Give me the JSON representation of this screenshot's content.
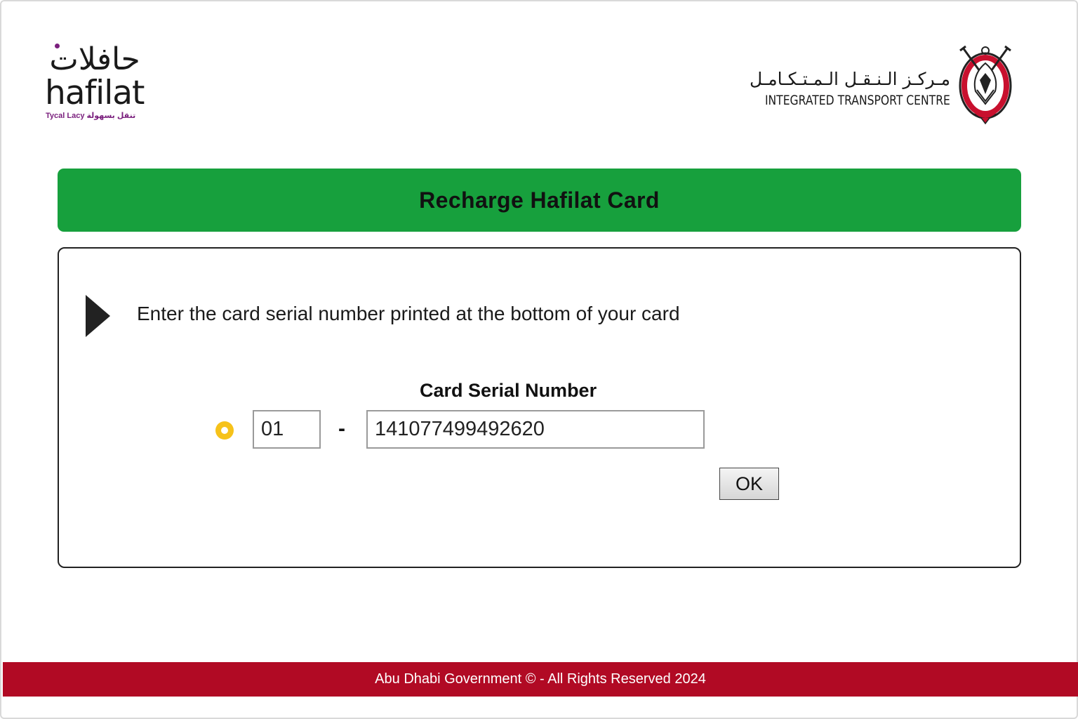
{
  "header": {
    "hafilat_logo": {
      "arabic": "حافلات",
      "english": "hafilat",
      "tagline": "Tycal Lacy  تنقل بسهولة"
    },
    "itc_logo": {
      "arabic": "مـركـز الـنـقـل الـمـتـكـامـل",
      "english": "INTEGRATED TRANSPORT CENTRE"
    }
  },
  "title": "Recharge Hafilat Card",
  "panel": {
    "instruction": "Enter the card serial number printed at the bottom of your card",
    "serial_label": "Card Serial Number",
    "prefix_value": "01",
    "separator": "-",
    "number_value": "141077499492620",
    "ok_label": "OK"
  },
  "footer": {
    "text": "Abu Dhabi Government © - All Rights Reserved 2024"
  },
  "colors": {
    "title_bar": "#17a03d",
    "footer": "#b10a24",
    "radio": "#f6c21a",
    "brand_purple": "#7a1f7d"
  }
}
